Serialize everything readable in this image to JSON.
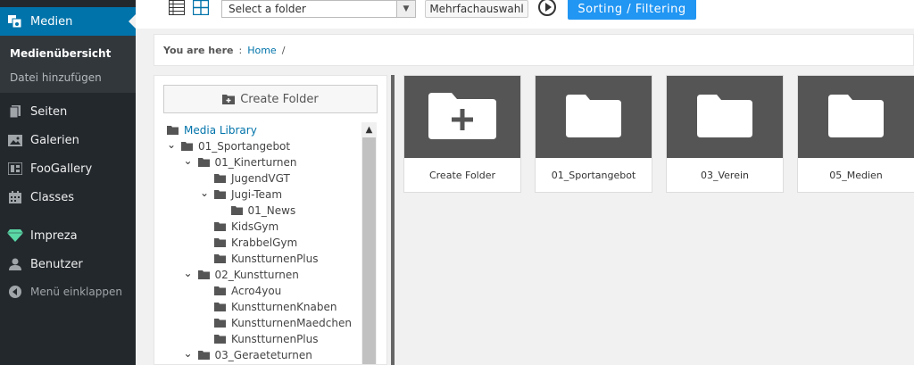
{
  "sidebar": {
    "media_label": "Medien",
    "submenu": {
      "overview_label": "Medienübersicht",
      "add_file_label": "Datei hinzufügen"
    },
    "items": [
      {
        "label": "Seiten",
        "icon": "pages-icon"
      },
      {
        "label": "Galerien",
        "icon": "gallery-icon"
      },
      {
        "label": "FooGallery",
        "icon": "foogallery-icon"
      },
      {
        "label": "Classes",
        "icon": "calendar-icon"
      },
      {
        "label": "Impreza",
        "icon": "diamond-icon"
      },
      {
        "label": "Benutzer",
        "icon": "user-icon"
      }
    ],
    "collapse_label": "Menü einklappen"
  },
  "toolbar": {
    "select_folder": "Select a folder",
    "multi_select_label": "Mehrfachauswahl",
    "sort_label": "Sorting / Filtering"
  },
  "breadcrumb": {
    "label": "You are here",
    "separator": ":",
    "home": "Home",
    "slash": "/"
  },
  "tree": {
    "create_folder_label": "Create Folder",
    "root_label": "Media Library",
    "nodes": [
      {
        "label": "01_Sportangebot",
        "depth": 0,
        "expanded": true
      },
      {
        "label": "01_Kinerturnen",
        "depth": 1,
        "expanded": true
      },
      {
        "label": "JugendVGT",
        "depth": 2,
        "expanded": null
      },
      {
        "label": "Jugi-Team",
        "depth": 2,
        "expanded": true
      },
      {
        "label": "01_News",
        "depth": 3,
        "expanded": null
      },
      {
        "label": "KidsGym",
        "depth": 2,
        "expanded": null
      },
      {
        "label": "KrabbelGym",
        "depth": 2,
        "expanded": null
      },
      {
        "label": "KunstturnenPlus",
        "depth": 2,
        "expanded": null
      },
      {
        "label": "02_Kunstturnen",
        "depth": 1,
        "expanded": true
      },
      {
        "label": "Acro4you",
        "depth": 2,
        "expanded": null
      },
      {
        "label": "KunstturnenKnaben",
        "depth": 2,
        "expanded": null
      },
      {
        "label": "KunstturnenMaedchen",
        "depth": 2,
        "expanded": null
      },
      {
        "label": "KunstturnenPlus",
        "depth": 2,
        "expanded": null
      },
      {
        "label": "03_Geraeteturnen",
        "depth": 1,
        "expanded": true
      }
    ]
  },
  "tiles": [
    {
      "label": "Create Folder",
      "kind": "create"
    },
    {
      "label": "01_Sportangebot",
      "kind": "folder"
    },
    {
      "label": "03_Verein",
      "kind": "folder"
    },
    {
      "label": "05_Medien",
      "kind": "folder"
    }
  ],
  "colors": {
    "accent": "#0073aa",
    "sort_button": "#2196f3",
    "sidebar_bg": "#23282d",
    "tile_bg": "#555555"
  }
}
